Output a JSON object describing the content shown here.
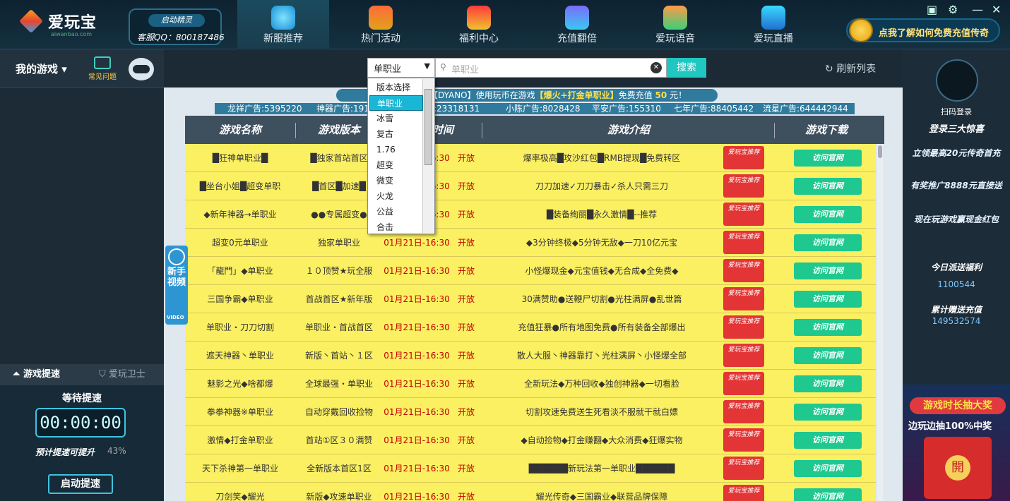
{
  "app": {
    "name": "爱玩宝",
    "domain": "aiwanbao.com",
    "service_badge": "启动精灵",
    "service_qq": "客服QQ：800187486"
  },
  "nav": {
    "tabs": [
      {
        "label": "新服推荐",
        "icon": "water-drop-icon",
        "active": true
      },
      {
        "label": "热门活动",
        "icon": "gift-box-icon"
      },
      {
        "label": "福利中心",
        "icon": "red-envelope-icon"
      },
      {
        "label": "充值翻倍",
        "icon": "recharge-icon"
      },
      {
        "label": "爱玩语音",
        "icon": "voice-chat-icon"
      },
      {
        "label": "爱玩直播",
        "icon": "tv-live-icon"
      }
    ],
    "promo": "点我了解如何免费充值传奇"
  },
  "left": {
    "my_games": "我的游戏",
    "faq": "常见问题",
    "tab_speed": "游戏提速",
    "tab_guard": "爱玩卫士",
    "wait": "等待提速",
    "timer": "00:00:00",
    "predict": "预计提速可提升",
    "predict_pct": "43%",
    "start": "启动提速",
    "video_label": "新手视频",
    "video_tag": "VIDEO"
  },
  "search": {
    "category": "单职业",
    "placeholder": "单职业",
    "button": "搜索",
    "refresh": "刷新列表"
  },
  "dropdown": {
    "options": [
      "版本选择",
      "单职业",
      "冰雪",
      "复古",
      "1.76",
      "超变",
      "微变",
      "火龙",
      "公益",
      "合击"
    ],
    "selected_index": 1
  },
  "ticker": {
    "prefix": "【DYANO】使用玩币在游戏",
    "highlight": "【爆火+打金单职业】",
    "suffix": "免费充值",
    "amount": "50",
    "unit": "元！"
  },
  "adline": [
    "龙祥广告:5395220",
    "神器广告:1918",
    "告:23318131",
    "小陈广告:8028428",
    "平安广告:155310",
    "七年广告:88405442",
    "流星广告:644442944"
  ],
  "table": {
    "headers": [
      "游戏名称",
      "游戏版本",
      "开服时间",
      "游戏介绍",
      "游戏下载"
    ],
    "rec_label": "爱玩宝推荐",
    "visit_label": "访问官网",
    "rows": [
      {
        "name": "█狂神单职业█",
        "version": "█独家首站首区",
        "time": "01月21日-16:30",
        "status": "开放",
        "intro": "爆率极高█攻沙红包█RMB提现█免费转区"
      },
      {
        "name": "█坐台小姐█超变单职",
        "version": "█首区█加速█",
        "time": "01月21日-16:30",
        "status": "开放",
        "intro": "刀刀加速✓刀刀暴击✓杀人只需三刀"
      },
      {
        "name": "◆新年神器→单职业",
        "version": "●●专属超变●",
        "time": "01月21日-16:30",
        "status": "开放",
        "intro": "█装备绚丽█永久激情█--推荐"
      },
      {
        "name": "超变0元单职业",
        "version": "独家单职业",
        "time": "01月21日-16:30",
        "status": "开放",
        "intro": "◆3分钟终极◆5分钟无敌◆一刀10亿元宝"
      },
      {
        "name": "「龍門」◆单职业",
        "version": "１０顶赞★玩全服",
        "time": "01月21日-16:30",
        "status": "开放",
        "intro": "小怪爆现金◆元宝值钱◆无合成◆全免费◆"
      },
      {
        "name": "三国争霸◆单职业",
        "version": "首战首区★新年版",
        "time": "01月21日-16:30",
        "status": "开放",
        "intro": "30满赞助●送鞭尸切割●光柱满屏●乱世篇"
      },
      {
        "name": "单职业・刀刀切割",
        "version": "单职业・首战首区",
        "time": "01月21日-16:30",
        "status": "开放",
        "intro": "充值狂暴●所有地图免费●所有装备全部爆出"
      },
      {
        "name": "遮天神器丶单职业",
        "version": "新版丶首站丶１区",
        "time": "01月21日-16:30",
        "status": "开放",
        "intro": "散人大服丶神器靠打丶光柱满屏丶小怪爆全部"
      },
      {
        "name": "魅影之光◆啥都爆",
        "version": "全球最强・单职业",
        "time": "01月21日-16:30",
        "status": "开放",
        "intro": "全新玩法◆万种回收◆独创神器◆一切看脸"
      },
      {
        "name": "拳拳神器※单职业",
        "version": "自动穿戴回收捡物",
        "time": "01月21日-16:30",
        "status": "开放",
        "intro": "切割攻速免费送生死看淡不服就干就白嫖"
      },
      {
        "name": "激情◆打金单职业",
        "version": "首站①区３０满赞",
        "time": "01月21日-16:30",
        "status": "开放",
        "intro": "◆自动捡物◆打金赚翻◆大众消费◆狂爆实物"
      },
      {
        "name": "天下杀神第一单职业",
        "version": "全新版本首区1区",
        "time": "01月21日-16:30",
        "status": "开放",
        "intro": "██████新玩法第一单职业██████"
      },
      {
        "name": "刀剑笑◆耀光",
        "version": "新版◆攻速单职业",
        "time": "01月21日-16:30",
        "status": "开放",
        "intro": "耀光传奇◆三国霸业◆联营品牌保障"
      }
    ]
  },
  "right": {
    "scan": "扫码登录",
    "gift": "登录三大惊喜",
    "p1": "立领最高20元传奇首充",
    "p2": "有奖推广8888元直接送",
    "p3": "现在玩游戏赢现金红包",
    "today_label": "今日派送福利",
    "today_val": "1100544",
    "total_label": "累计赠送充值",
    "total_val": "149532574",
    "ad_t1": "游戏时长抽大奖",
    "ad_t2": "边玩边抽100%中奖"
  }
}
